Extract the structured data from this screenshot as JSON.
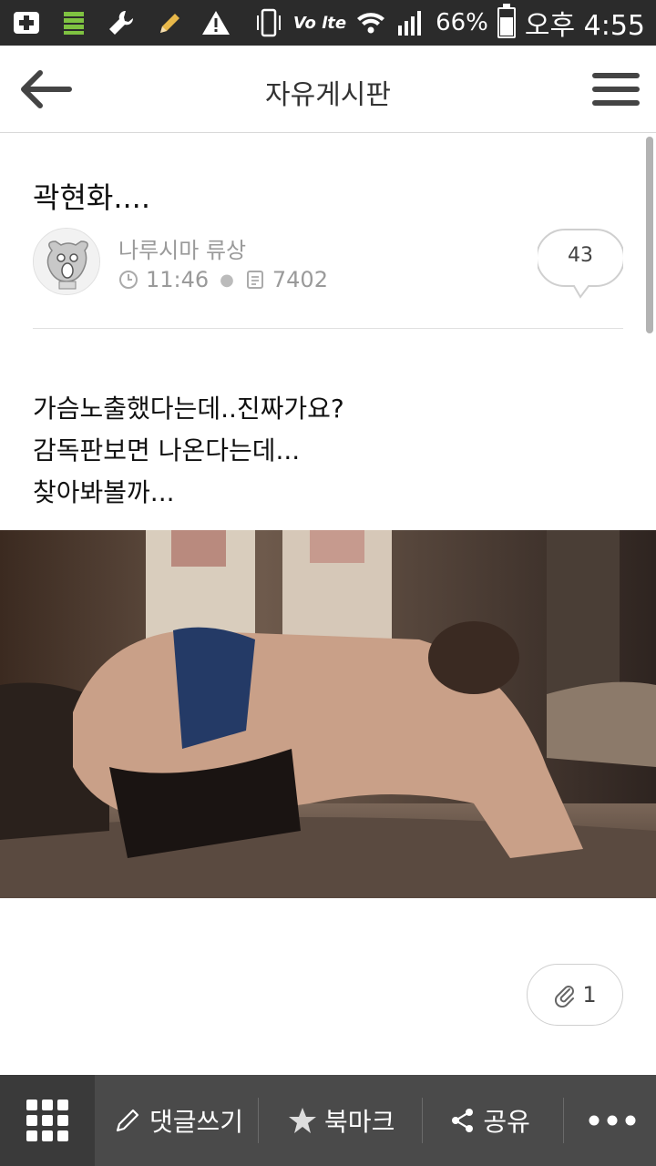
{
  "status_bar": {
    "network_label": "Vo lte",
    "battery_percent": "66%",
    "battery_level": 0.66,
    "time": "오후 4:55"
  },
  "header": {
    "title": "자유게시판"
  },
  "post": {
    "title": "곽현화....",
    "author": "나루시마 류상",
    "time": "11:46",
    "views": "7402",
    "comment_count": "43",
    "body_lines": [
      "가슴노출했다는데..진짜가요?",
      "감독판보면 나온다는데...",
      "찾아봐볼까..."
    ],
    "attachment_count": "1"
  },
  "bottom_bar": {
    "comment_label": "댓글쓰기",
    "bookmark_label": "북마크",
    "share_label": "공유"
  },
  "colors": {
    "status_bar_bg": "#2b2b2b",
    "bottom_bar_bg": "#4a4a4a",
    "bottom_grid_bg": "#3a3a3a"
  }
}
